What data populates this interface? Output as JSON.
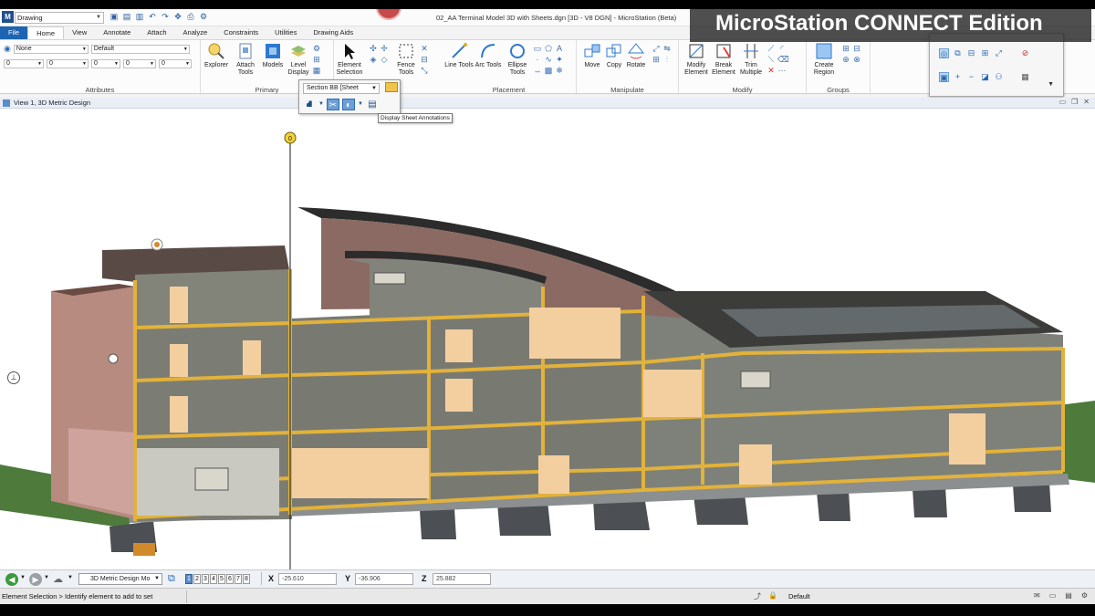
{
  "window": {
    "document_title": "02_AA Terminal Model 3D with Sheets.dgn [3D - V8 DGN] - MicroStation (Beta)",
    "workflow": "Drawing",
    "app_logo": "M"
  },
  "overlay": {
    "title": "MicroStation CONNECT Edition"
  },
  "tabs": [
    "File",
    "Home",
    "Annotate",
    "Attach",
    "Analyze",
    "Constraints",
    "Utilities",
    "Drawing Aids"
  ],
  "attributes": {
    "level": "None",
    "style": "Default",
    "color": "0",
    "weight": "0",
    "line_style": "0",
    "transparency": "0",
    "priority": "0",
    "label": "Attributes"
  },
  "groups": {
    "primary": "Primary",
    "placement": "Placement",
    "manipulate": "Manipulate",
    "modify": "Modify",
    "groups": "Groups"
  },
  "buttons": {
    "explorer": "Explorer",
    "attach_tools": "Attach Tools",
    "models": "Models",
    "level_display": "Level Display",
    "element_selection": "Element Selection",
    "fence_tools": "Fence Tools",
    "line_tools": "Line Tools",
    "arc_tools": "Arc Tools",
    "ellipse_tools": "Ellipse Tools",
    "move": "Move",
    "copy": "Copy",
    "rotate": "Rotate",
    "modify_element": "Modify Element",
    "break_element": "Break Element",
    "trim_multiple": "Trim Multiple",
    "create_region": "Create Region"
  },
  "section_popup": {
    "combo": "Section BB [Sheet",
    "tooltip": "Display Sheet Annotations"
  },
  "view": {
    "title": "View 1, 3D Metric Design",
    "callout_marker": "0"
  },
  "nav": {
    "model": "3D Metric Design Mo",
    "views": [
      "1",
      "2",
      "3",
      "4",
      "5",
      "6",
      "7",
      "8"
    ],
    "x_label": "X",
    "y_label": "Y",
    "z_label": "Z",
    "x": "-25.610",
    "y": "-36.906",
    "z": "25.882"
  },
  "status": {
    "message": "Element Selection > Identify element to add to set",
    "active_level": "Default"
  },
  "colors": {
    "accent": "#1e64b4",
    "structure_yellow": "#e8b63a",
    "wall_gray": "#7f8279",
    "interior_tan": "#f3cfa0",
    "roof_brown": "#8a6a62"
  }
}
